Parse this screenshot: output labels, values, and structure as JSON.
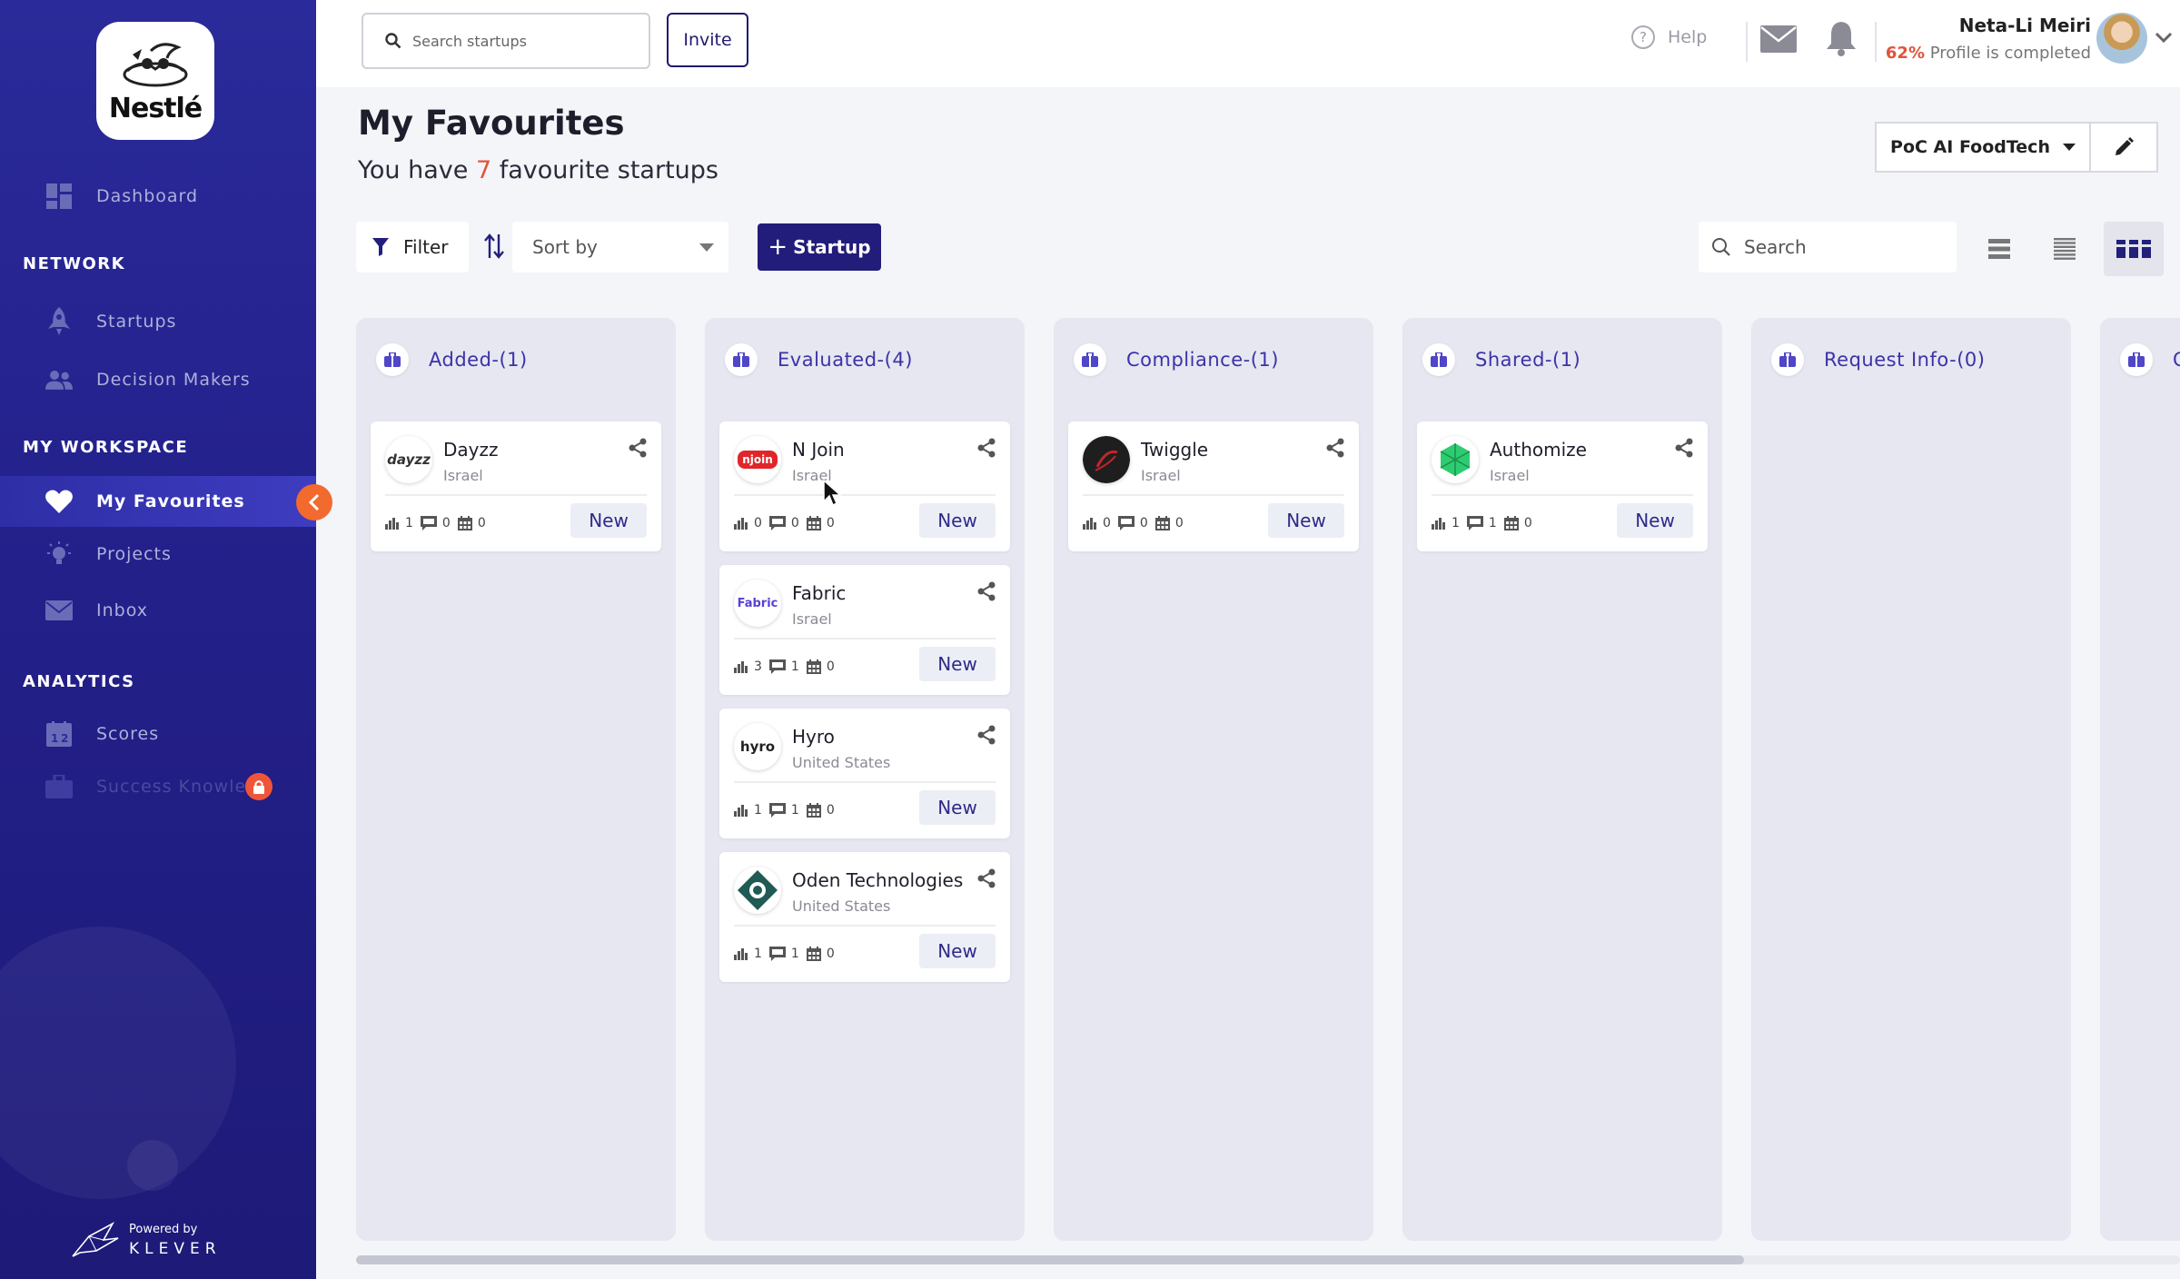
{
  "brand": {
    "logo_text": "Nestlé"
  },
  "sidebar": {
    "dashboard": {
      "label": "Dashboard",
      "icon": "dashboard-icon"
    },
    "network": {
      "title": "NETWORK",
      "items": [
        {
          "label": "Startups",
          "icon": "rocket-icon"
        },
        {
          "label": "Decision Makers",
          "icon": "people-icon"
        }
      ]
    },
    "workspace": {
      "title": "MY  WORKSPACE",
      "items": [
        {
          "label": "My Favourites",
          "icon": "heart-icon",
          "active": true
        },
        {
          "label": "Projects",
          "icon": "bulb-icon"
        },
        {
          "label": "Inbox",
          "icon": "mail-icon"
        }
      ]
    },
    "analytics": {
      "title": "ANALYTICS",
      "items": [
        {
          "label": "Scores",
          "icon": "scores-icon"
        },
        {
          "label": "Success Knowled",
          "icon": "briefcase-icon",
          "locked": true
        }
      ]
    },
    "powered_by": "Powered by",
    "powered_brand": "KLEVER"
  },
  "topbar": {
    "search_placeholder": "Search startups",
    "invite_label": "Invite",
    "help_label": "Help",
    "user": {
      "name": "Neta-Li Meiri",
      "profile_pct": "62%",
      "profile_text": " Profile is completed"
    }
  },
  "page": {
    "title": "My Favourites",
    "subtitle_prefix": "You have ",
    "count": "7",
    "subtitle_suffix": " favourite startups",
    "project": "PoC AI FoodTech"
  },
  "toolbar": {
    "filter_label": "Filter",
    "sort_placeholder": "Sort by",
    "add_label": "Startup",
    "search_placeholder": "Search"
  },
  "columns": [
    {
      "title": "Added-(1)",
      "cards": [
        {
          "name": "Dayzz",
          "location": "Israel",
          "stats": [
            "1",
            "0",
            "0"
          ],
          "status": "New",
          "logo": "dayzz"
        }
      ]
    },
    {
      "title": "Evaluated-(4)",
      "cards": [
        {
          "name": "N Join",
          "location": "Israel",
          "stats": [
            "0",
            "0",
            "0"
          ],
          "status": "New",
          "logo": "njoin"
        },
        {
          "name": "Fabric",
          "location": "Israel",
          "stats": [
            "3",
            "1",
            "0"
          ],
          "status": "New",
          "logo": "fabric"
        },
        {
          "name": "Hyro",
          "location": "United States",
          "stats": [
            "1",
            "1",
            "0"
          ],
          "status": "New",
          "logo": "hyro"
        },
        {
          "name": "Oden Technologies",
          "location": "United States",
          "stats": [
            "1",
            "1",
            "0"
          ],
          "status": "New",
          "logo": "oden"
        }
      ]
    },
    {
      "title": "Compliance-(1)",
      "cards": [
        {
          "name": "Twiggle",
          "location": "Israel",
          "stats": [
            "0",
            "0",
            "0"
          ],
          "status": "New",
          "logo": "twiggle"
        }
      ]
    },
    {
      "title": "Shared-(1)",
      "cards": [
        {
          "name": "Authomize",
          "location": "Israel",
          "stats": [
            "1",
            "1",
            "0"
          ],
          "status": "New",
          "logo": "authomize"
        }
      ]
    },
    {
      "title": "Request Info-(0)",
      "cards": []
    },
    {
      "title": "C",
      "cards": []
    }
  ],
  "colors": {
    "sidebar": "#23208a",
    "accent": "#221c7a",
    "highlight": "#e2533b",
    "column_title": "#3d32a8"
  }
}
